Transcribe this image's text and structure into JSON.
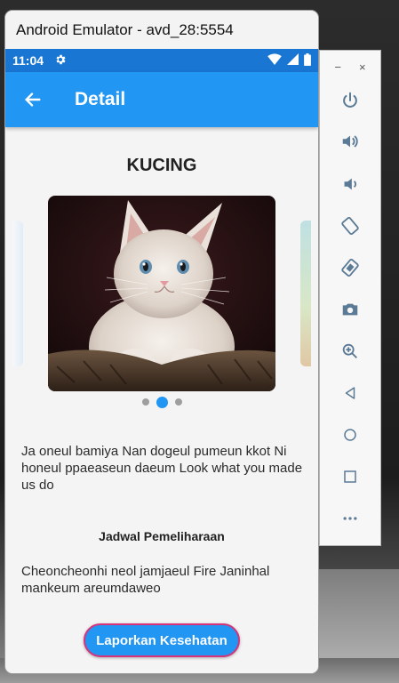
{
  "window": {
    "title": "Android Emulator - avd_28:5554"
  },
  "status_bar": {
    "time": "11:04"
  },
  "app_bar": {
    "title": "Detail"
  },
  "detail": {
    "heading": "KUCING",
    "description": "Ja oneul bamiya Nan dogeul pumeun kkot Ni honeul ppaeaseun daeum Look what you made us do",
    "schedule_heading": "Jadwal Pemeliharaan",
    "schedule_text": "Cheoncheonhi neol jamjaeul Fire Janinhal mankeum areumdaweo",
    "report_button": "Laporkan Kesehatan"
  },
  "carousel": {
    "slide_count": 3,
    "active_index": 1
  },
  "toolbar": {
    "minimize": "−",
    "close": "×",
    "buttons": [
      "power-icon",
      "volume-up-icon",
      "volume-down-icon",
      "rotate-left-icon",
      "rotate-right-icon",
      "camera-icon",
      "zoom-icon",
      "back-icon",
      "home-icon",
      "overview-icon",
      "more-icon"
    ]
  },
  "colors": {
    "primary": "#2196f3",
    "status": "#1976d2",
    "button_border": "#d6337a"
  }
}
